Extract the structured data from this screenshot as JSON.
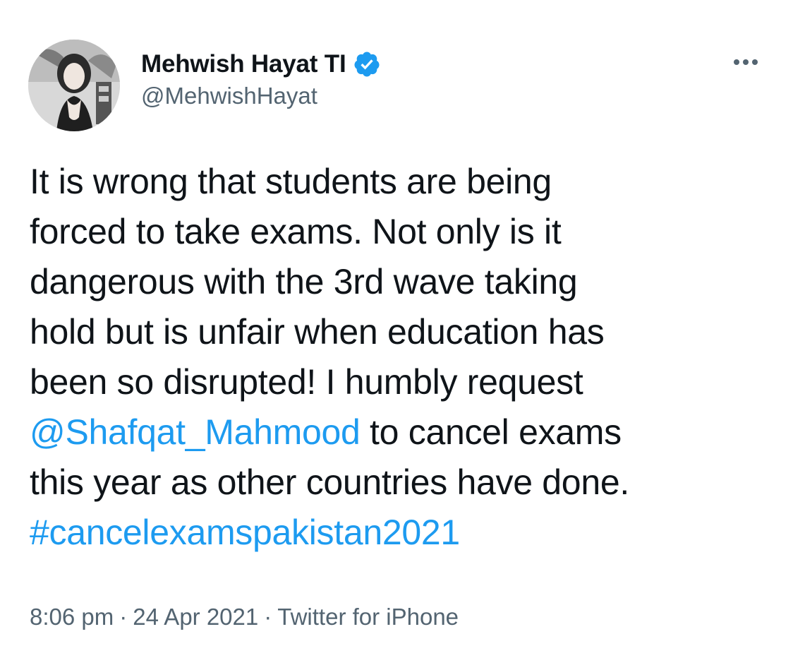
{
  "author": {
    "name": "Mehwish Hayat TI",
    "handle": "@MehwishHayat",
    "verified_icon": "verified-badge-icon",
    "accent_color": "#1d9bf0"
  },
  "tweet": {
    "line1": "It is wrong that students are being",
    "line2": "forced to take exams. Not only is it",
    "line3": "dangerous with the 3rd wave taking",
    "line4": "hold but is unfair when education has",
    "line5": "been so disrupted! I humbly request",
    "mention": "@Shafqat_Mahmood",
    "line6_rest": " to cancel exams",
    "line7": "this year as other countries have done.",
    "hashtag": "#cancelexamspakistan2021"
  },
  "meta": {
    "time": "8:06 pm",
    "separator": "·",
    "date": "24 Apr 2021",
    "source": "Twitter for iPhone"
  },
  "icons": {
    "more": "more-options-icon"
  }
}
